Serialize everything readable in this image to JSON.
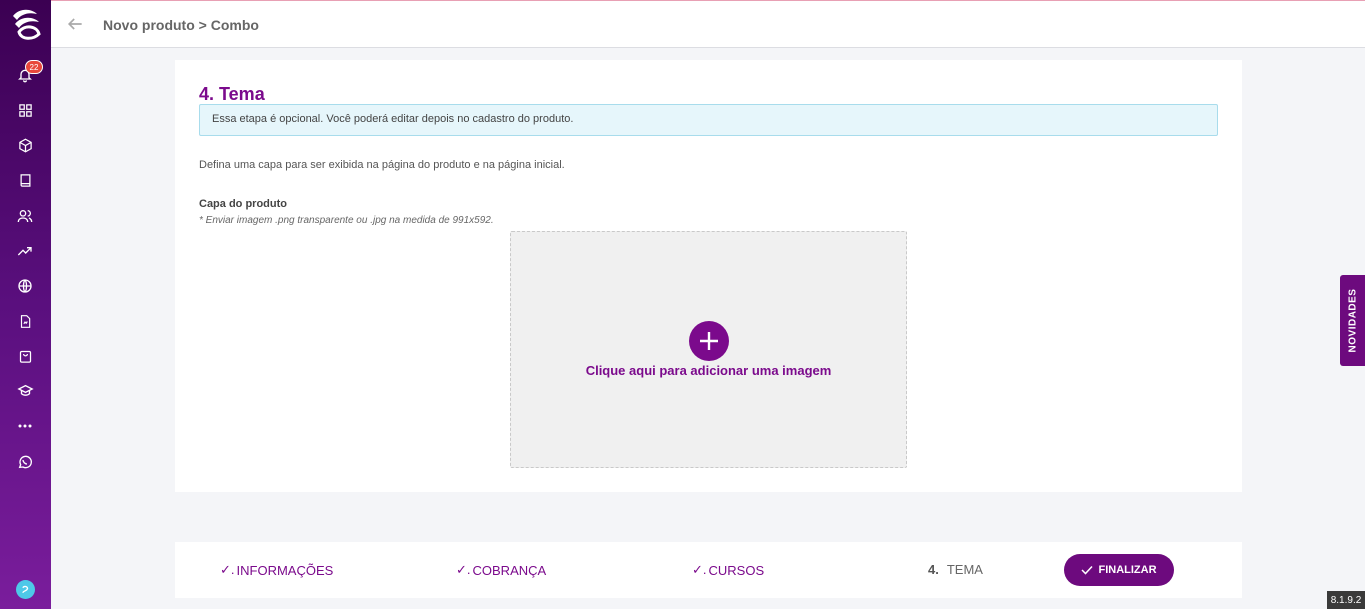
{
  "header": {
    "breadcrumb": "Novo produto > Combo"
  },
  "sidebar": {
    "notification_count": "22",
    "icons": [
      "bell-icon",
      "dashboard-icon",
      "box-icon",
      "book-icon",
      "users-icon",
      "trending-icon",
      "globe-icon",
      "document-icon",
      "bag-icon",
      "graduation-icon",
      "more-icon",
      "whatsapp-icon"
    ]
  },
  "section": {
    "title": "4. Tema",
    "info": "Essa etapa é opcional. Você poderá editar depois no cadastro do produto.",
    "description": "Defina uma capa para ser exibida na página do produto e na página inicial.",
    "cover_label": "Capa do produto",
    "cover_hint": "* Enviar imagem .png transparente ou .jpg na medida de 991x592.",
    "upload_text": "Clique aqui para adicionar uma imagem"
  },
  "steps": [
    {
      "label": "INFORMAÇÕES",
      "done": true
    },
    {
      "label": "COBRANÇA",
      "done": true
    },
    {
      "label": "CURSOS",
      "done": true
    },
    {
      "number": "4.",
      "label": "TEMA",
      "done": false
    }
  ],
  "finalize_label": "FINALIZAR",
  "novidades_label": "NOVIDADES",
  "version": "8.1.9.2",
  "colors": {
    "brand": "#7b0a8c",
    "info_bg": "#e6f6fb"
  }
}
